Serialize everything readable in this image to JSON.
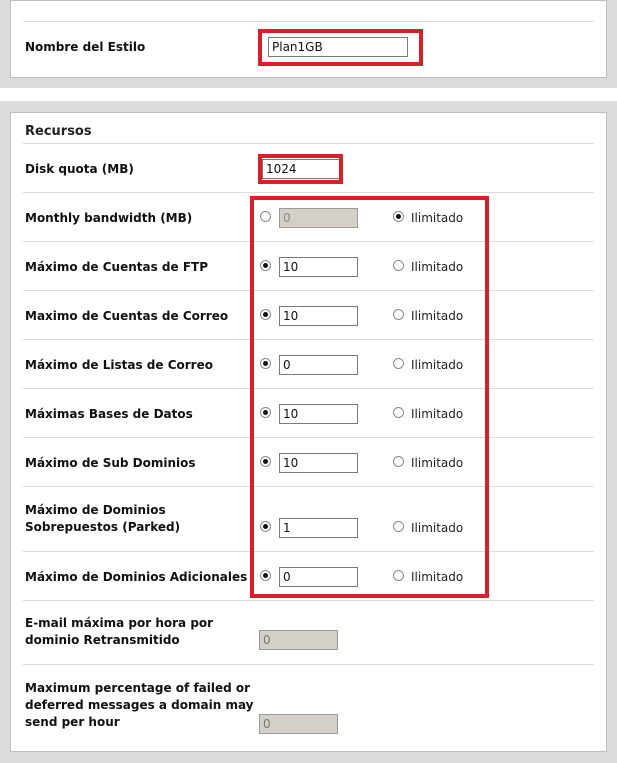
{
  "style_section": {
    "name_label": "Nombre del Estilo",
    "name_value": "Plan1GB"
  },
  "resources": {
    "title": "Recursos",
    "disk_quota": {
      "label": "Disk quota (MB)",
      "value": "1024"
    },
    "unlimited_label": "Ilimitado",
    "rows": [
      {
        "label": "Monthly bandwidth (MB)",
        "value": "0",
        "selected": "unlimited"
      },
      {
        "label": "Máximo de Cuentas de FTP",
        "value": "10",
        "selected": "value"
      },
      {
        "label": "Maximo de Cuentas de Correo",
        "value": "10",
        "selected": "value"
      },
      {
        "label": "Máximo de Listas de Correo",
        "value": "0",
        "selected": "value"
      },
      {
        "label": "Máximas Bases de Datos",
        "value": "10",
        "selected": "value"
      },
      {
        "label": "Máximo de Sub Dominios",
        "value": "10",
        "selected": "value"
      },
      {
        "label": "Máximo de Dominios Sobrepuestos (Parked)",
        "value": "1",
        "selected": "value"
      },
      {
        "label": "Máximo de Dominios Adicionales",
        "value": "0",
        "selected": "value"
      }
    ],
    "email_relay": {
      "label": "E-mail máxima por hora por dominio Retransmitido",
      "placeholder": "0"
    },
    "failed_pct": {
      "label": "Maximum percentage of failed or deferred messages a domain may send per hour",
      "placeholder": "0"
    }
  },
  "colors": {
    "highlight": "#d9202a",
    "panel_bg": "#dcdcdc",
    "disabled_field": "#d4d0c8"
  }
}
